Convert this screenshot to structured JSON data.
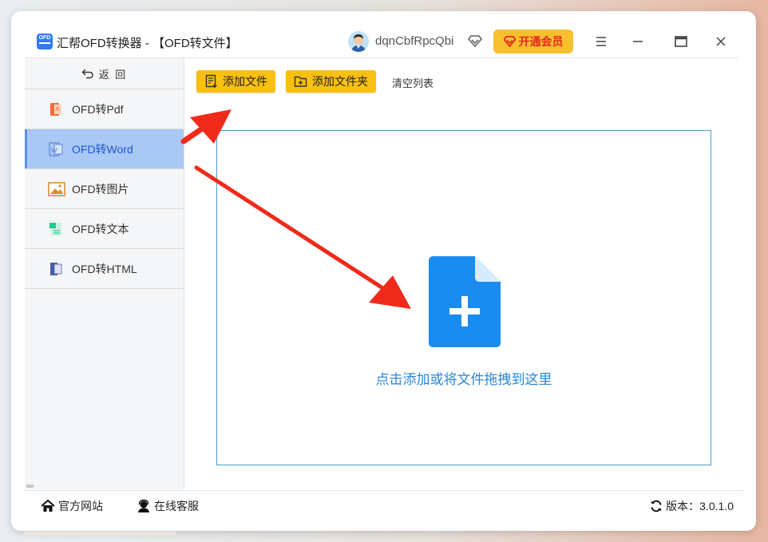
{
  "app": {
    "logo_text": "OFD",
    "title": "汇帮OFD转换器 - 【OFD转文件】"
  },
  "user": {
    "name": "dqnCbfRpcQbi",
    "vip_label": "开通会员"
  },
  "sidebar": {
    "back_label": "返 回",
    "items": [
      {
        "label": "OFD转Pdf",
        "icon": "pdf-icon",
        "active": false
      },
      {
        "label": "OFD转Word",
        "icon": "word-icon",
        "active": true
      },
      {
        "label": "OFD转图片",
        "icon": "image-icon",
        "active": false
      },
      {
        "label": "OFD转文本",
        "icon": "text-icon",
        "active": false
      },
      {
        "label": "OFD转HTML",
        "icon": "html-icon",
        "active": false
      }
    ]
  },
  "toolbar": {
    "add_file": "添加文件",
    "add_folder": "添加文件夹",
    "clear_list": "清空列表"
  },
  "dropzone": {
    "text": "点击添加或将文件拖拽到这里"
  },
  "footer": {
    "website": "官方网站",
    "support": "在线客服",
    "version_label": "版本：3.0.1.0"
  },
  "colors": {
    "accent_yellow": "#f8c010",
    "active_nav": "#aac8f5",
    "drop_blue": "#2a86d8",
    "arrow_red": "#f02a1a"
  }
}
